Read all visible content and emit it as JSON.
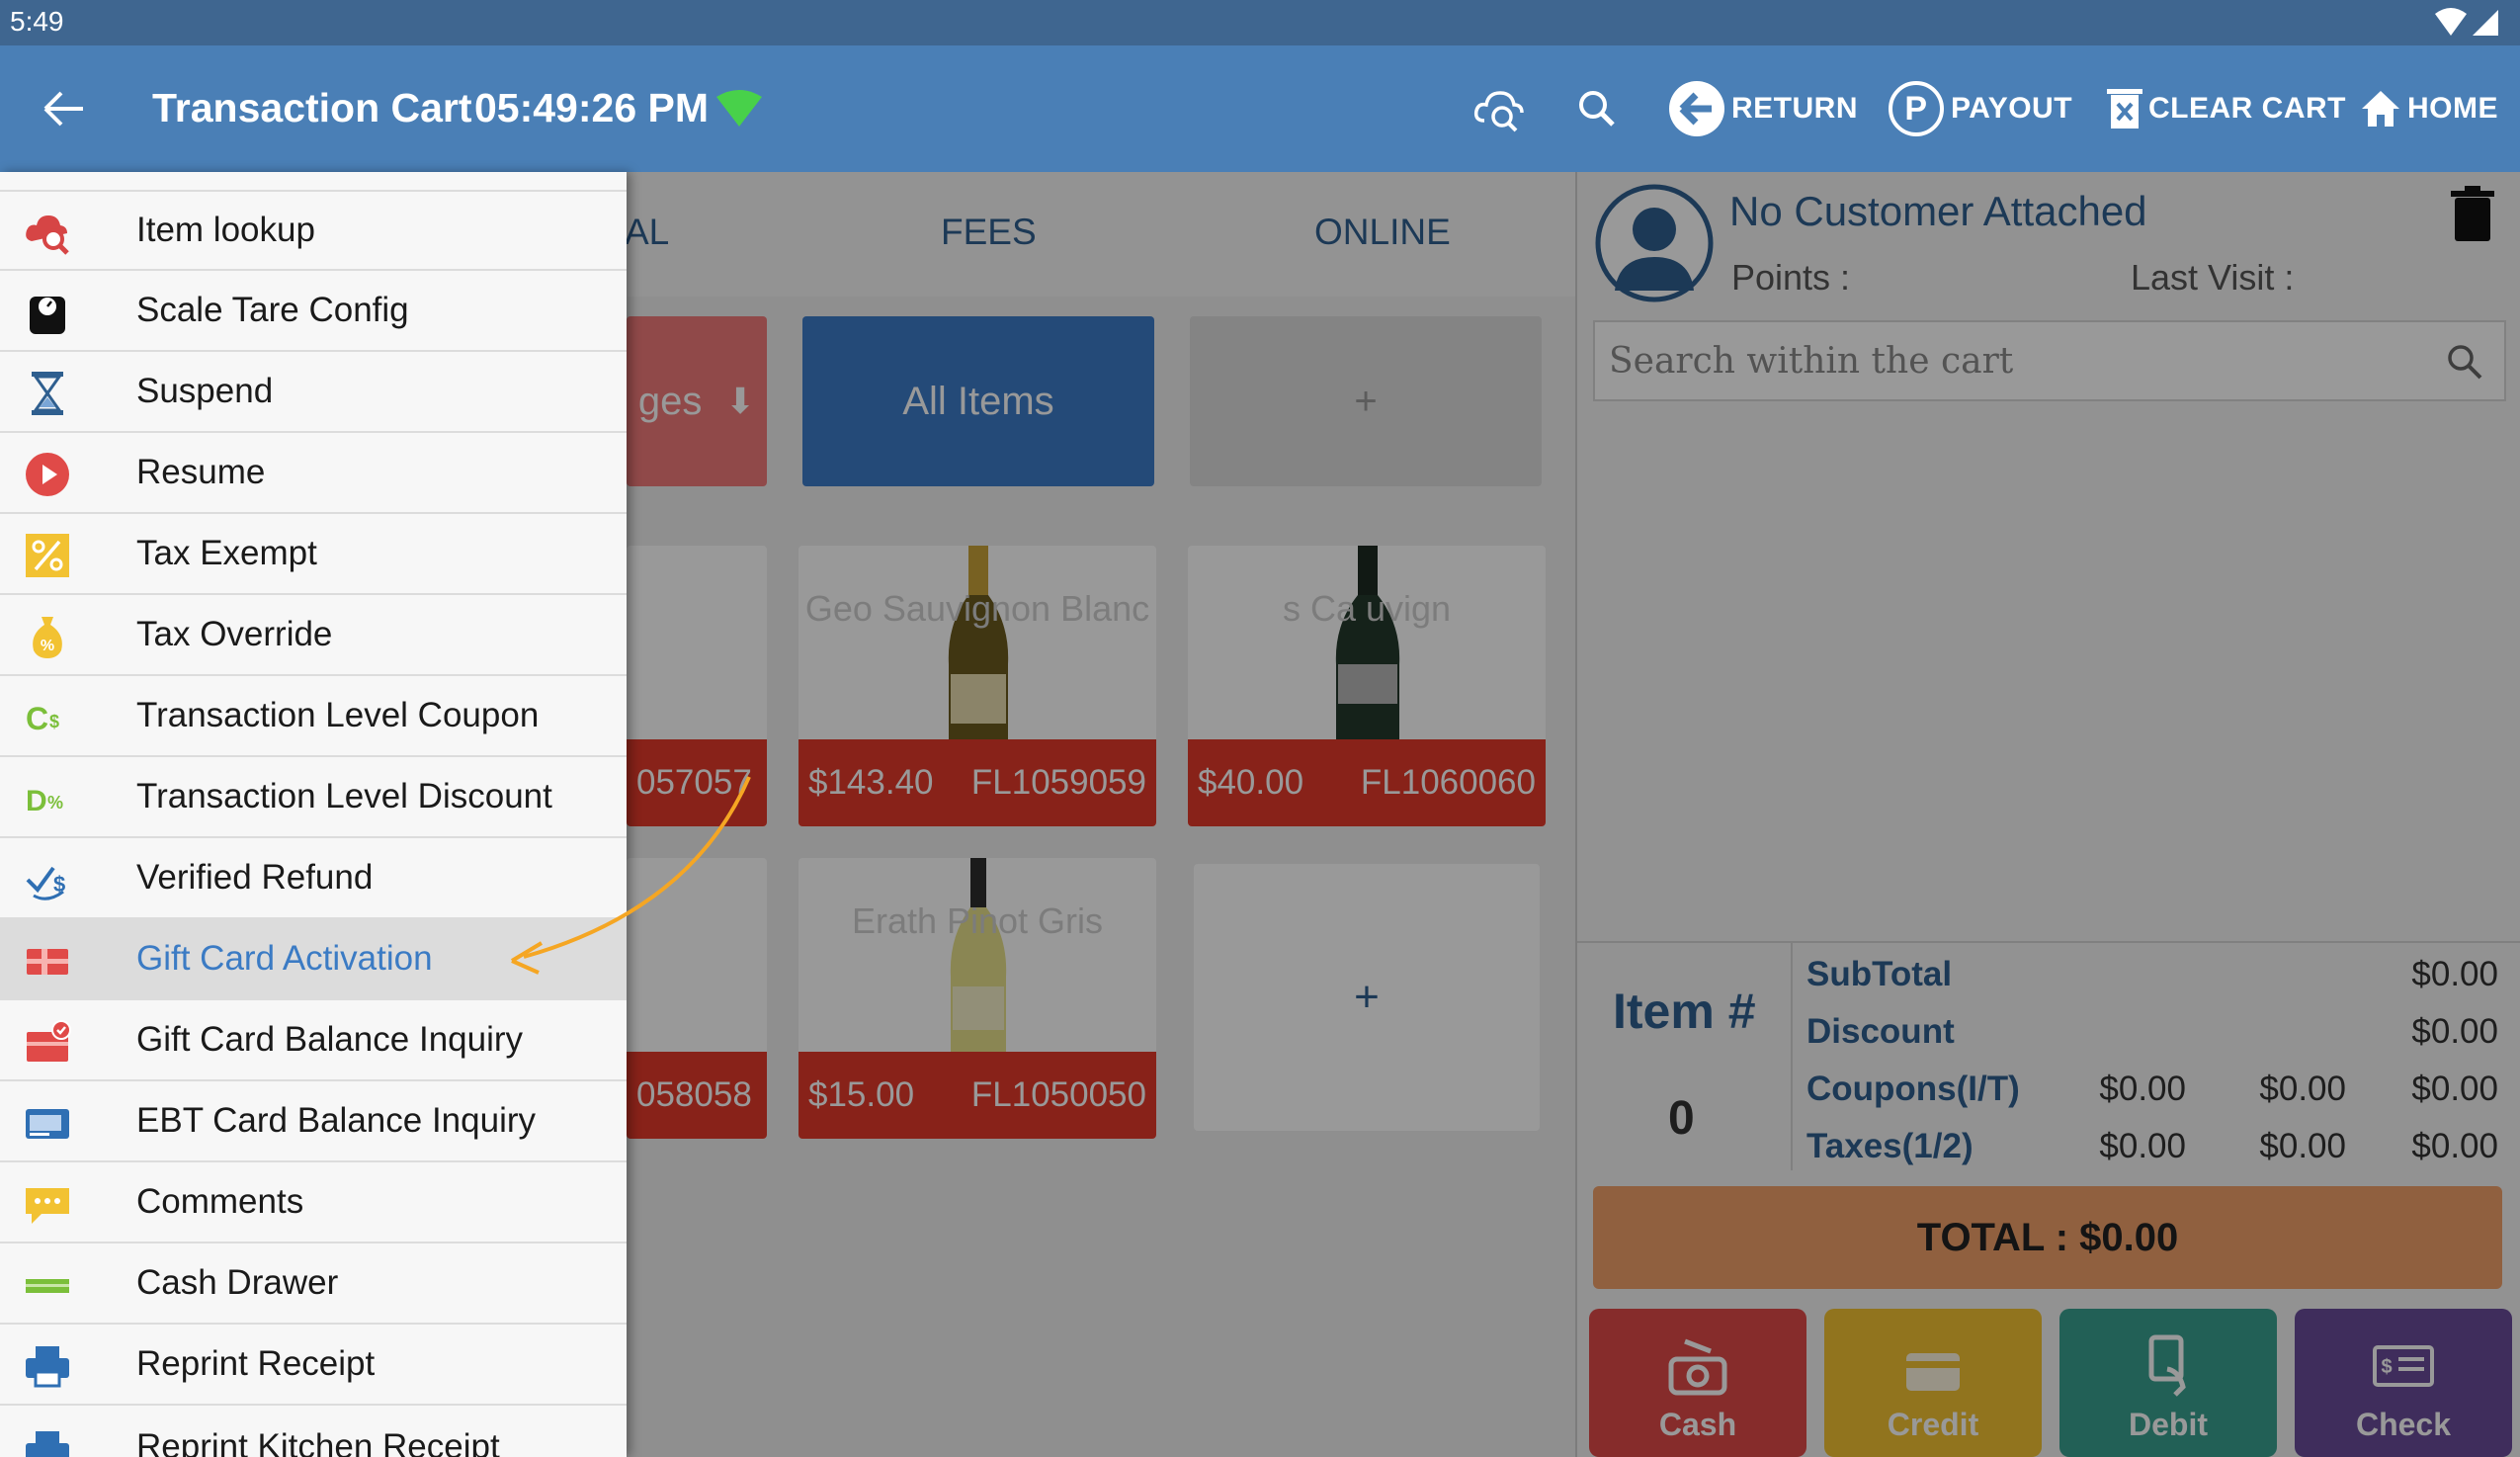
{
  "status_bar": {
    "time": "5:49"
  },
  "app_bar": {
    "title": "Transaction Cart",
    "clock": "05:49:26 PM",
    "actions": {
      "return": "RETURN",
      "payout": "PAYOUT",
      "clear_cart": "CLEAR CART",
      "home": "HOME"
    }
  },
  "tabs": [
    "AL",
    "FEES",
    "ONLINE"
  ],
  "categories": {
    "partial": "ges",
    "all_items": "All Items",
    "add": "+"
  },
  "products": [
    {
      "name": "",
      "price": "",
      "sku": "057057"
    },
    {
      "name": "Geo Sauvignon Blanc",
      "price": "$143.40",
      "sku": "FL1059059"
    },
    {
      "name": "s Ca uvign",
      "price": "$40.00",
      "sku": "FL1060060"
    },
    {
      "name": "",
      "price": "",
      "sku": "058058"
    },
    {
      "name": "Erath Pinot Gris",
      "price": "$15.00",
      "sku": "FL1050050"
    }
  ],
  "add_product": "+",
  "drawer": {
    "items": [
      {
        "label": "Item lookup",
        "icon": "cloud-search-icon"
      },
      {
        "label": "Scale Tare Config",
        "icon": "scale-icon"
      },
      {
        "label": "Suspend",
        "icon": "hourglass-icon"
      },
      {
        "label": "Resume",
        "icon": "play-icon"
      },
      {
        "label": "Tax Exempt",
        "icon": "percent-icon"
      },
      {
        "label": "Tax Override",
        "icon": "money-bag-icon"
      },
      {
        "label": "Transaction Level Coupon",
        "icon": "coupon-icon"
      },
      {
        "label": "Transaction Level Discount",
        "icon": "discount-icon"
      },
      {
        "label": "Verified Refund",
        "icon": "refund-icon"
      },
      {
        "label": "Gift Card Activation",
        "icon": "gift-card-icon"
      },
      {
        "label": "Gift Card Balance Inquiry",
        "icon": "gift-card-balance-icon"
      },
      {
        "label": "EBT Card Balance Inquiry",
        "icon": "ebt-card-icon"
      },
      {
        "label": "Comments",
        "icon": "comment-icon"
      },
      {
        "label": "Cash Drawer",
        "icon": "cash-drawer-icon"
      },
      {
        "label": "Reprint Receipt",
        "icon": "printer-icon"
      },
      {
        "label": "Reprint Kitchen Receipt",
        "icon": "printer-icon"
      }
    ],
    "active": "Gift Card Activation"
  },
  "cart": {
    "customer_name": "No Customer Attached",
    "points_label": "Points :",
    "last_visit_label": "Last Visit :",
    "search_placeholder": "Search within the cart",
    "item_label": "Item #",
    "item_count": "0",
    "rows": [
      {
        "label": "SubTotal",
        "values": [
          "",
          "",
          "$0.00"
        ]
      },
      {
        "label": "Discount",
        "values": [
          "",
          "",
          "$0.00"
        ]
      },
      {
        "label": "Coupons(I/T)",
        "values": [
          "$0.00",
          "$0.00",
          "$0.00"
        ]
      },
      {
        "label": "Taxes(1/2)",
        "values": [
          "$0.00",
          "$0.00",
          "$0.00"
        ]
      }
    ],
    "total": "TOTAL : $0.00",
    "payments": [
      "Cash",
      "Credit",
      "Debit",
      "Check"
    ]
  },
  "colors": {
    "app_bar": "#4a7fb6",
    "price_bar": "#e33a2a",
    "total_bar": "#f0a06a",
    "cash": "#e04a48",
    "credit": "#f2c232",
    "debit": "#3aa08f",
    "check": "#6a4c9a",
    "annotation_arrow": "#f5a623"
  }
}
